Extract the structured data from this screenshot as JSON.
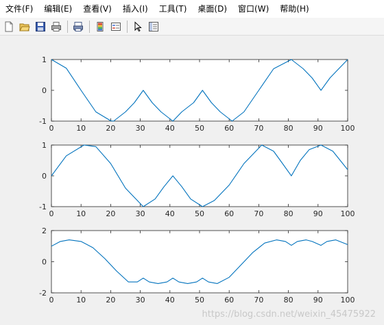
{
  "menu": {
    "items": [
      "文件(F)",
      "编辑(E)",
      "查看(V)",
      "插入(I)",
      "工具(T)",
      "桌面(D)",
      "窗口(W)",
      "帮助(H)"
    ]
  },
  "toolbar": {
    "icons": [
      "new-figure-icon",
      "open-file-icon",
      "save-icon",
      "print-icon",
      "print-preview-icon",
      "colorbar-icon",
      "legend-icon",
      "select-pointer-icon",
      "property-editor-icon"
    ]
  },
  "colors": {
    "line": "#0072bd",
    "axes_bg": "#ffffff",
    "figure_bg": "#f0f0f0",
    "axis_color": "#262626"
  },
  "watermark": "https://blog.csdn.net/weixin_45475922",
  "chart_data": [
    {
      "type": "line",
      "xlim": [
        0,
        100
      ],
      "ylim": [
        -1,
        1
      ],
      "xticks": [
        0,
        10,
        20,
        30,
        40,
        50,
        60,
        70,
        80,
        90,
        100
      ],
      "yticks": [
        -1,
        0,
        1
      ],
      "series": [
        {
          "x": [
            0,
            5,
            10,
            15,
            20,
            21,
            25,
            28,
            31,
            34,
            37,
            41,
            44,
            48,
            51,
            54,
            57,
            61,
            65,
            70,
            75,
            81,
            85,
            88,
            91,
            94,
            97,
            100
          ],
          "y": [
            1,
            0.72,
            0,
            -0.7,
            -0.99,
            -1,
            -0.7,
            -0.4,
            0,
            -0.4,
            -0.7,
            -1,
            -0.7,
            -0.4,
            0,
            -0.4,
            -0.7,
            -1,
            -0.7,
            0,
            0.7,
            1,
            0.7,
            0.4,
            0,
            0.4,
            0.7,
            1
          ]
        }
      ]
    },
    {
      "type": "line",
      "xlim": [
        0,
        100
      ],
      "ylim": [
        -1,
        1
      ],
      "xticks": [
        0,
        10,
        20,
        30,
        40,
        50,
        60,
        70,
        80,
        90,
        100
      ],
      "yticks": [
        -1,
        0,
        1
      ],
      "series": [
        {
          "x": [
            0,
            5,
            11,
            15,
            20,
            25,
            31,
            35,
            38,
            41,
            44,
            47,
            51,
            55,
            60,
            65,
            71,
            75,
            78,
            81,
            84,
            87,
            91,
            95,
            100
          ],
          "y": [
            0,
            0.65,
            1,
            0.95,
            0.4,
            -0.4,
            -1,
            -0.75,
            -0.35,
            0,
            -0.35,
            -0.75,
            -1,
            -0.8,
            -0.3,
            0.4,
            1,
            0.8,
            0.4,
            0,
            0.5,
            0.85,
            1,
            0.8,
            0.2
          ]
        }
      ]
    },
    {
      "type": "line",
      "xlim": [
        0,
        100
      ],
      "ylim": [
        -2,
        2
      ],
      "xticks": [
        0,
        10,
        20,
        30,
        40,
        50,
        60,
        70,
        80,
        90,
        100
      ],
      "yticks": [
        -2,
        0,
        2
      ],
      "series": [
        {
          "x": [
            0,
            3,
            6,
            10,
            14,
            18,
            22,
            26,
            29,
            31,
            33,
            36,
            39,
            41,
            43,
            46,
            49,
            51,
            53,
            56,
            60,
            64,
            68,
            72,
            76,
            79,
            81,
            83,
            86,
            88,
            91,
            93,
            96,
            100
          ],
          "y": [
            1.0,
            1.3,
            1.4,
            1.3,
            0.9,
            0.2,
            -0.6,
            -1.3,
            -1.3,
            -1.05,
            -1.3,
            -1.4,
            -1.3,
            -1.05,
            -1.3,
            -1.4,
            -1.3,
            -1.05,
            -1.3,
            -1.4,
            -1.0,
            -0.2,
            0.6,
            1.2,
            1.4,
            1.3,
            1.05,
            1.3,
            1.4,
            1.3,
            1.05,
            1.3,
            1.4,
            1.1
          ]
        }
      ]
    }
  ]
}
